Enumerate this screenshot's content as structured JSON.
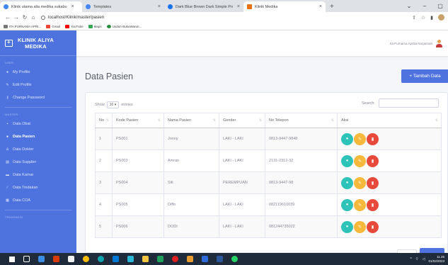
{
  "browser": {
    "tabs": [
      {
        "label": "Klinik utama alia medika sukabu",
        "favicon_color": "#4285f4"
      },
      {
        "label": "Templates",
        "favicon_color": "#4285f4"
      },
      {
        "label": "Dark Blue Brown Dark Simple Pro",
        "favicon_color": "#1a73e8"
      },
      {
        "label": "Klinik Medika",
        "favicon_color": "#e8710a"
      }
    ],
    "url": "localhost/Klinik/master/pasien",
    "bookmarks": [
      {
        "label": "ITA PURNAMA APRI...",
        "color": "#555"
      },
      {
        "label": "Gmail",
        "color": "#ea4335"
      },
      {
        "label": "YouTube",
        "color": "#ff0000"
      },
      {
        "label": "Maps",
        "color": "#34a853"
      },
      {
        "label": "Unduh BukuWarun...",
        "color": "#2a8f3f"
      }
    ]
  },
  "sidebar": {
    "brand_line1": "KLINIK ALIYA",
    "brand_line2": "MEDIKA",
    "sections": {
      "user": "USER",
      "master": "MASTER",
      "transaksi": "TRANSAKSI"
    },
    "user_items": [
      {
        "label": "My Profile",
        "icon": "user-icon"
      },
      {
        "label": "Edit Profile",
        "icon": "user-edit-icon"
      },
      {
        "label": "Change Password",
        "icon": "key-icon"
      }
    ],
    "master_items": [
      {
        "label": "Data Obat",
        "icon": "pills-icon"
      },
      {
        "label": "Data Pasien",
        "icon": "users-icon",
        "active": true
      },
      {
        "label": "Data Dokter",
        "icon": "doctor-icon"
      },
      {
        "label": "Data Supplier",
        "icon": "building-icon"
      },
      {
        "label": "Data Kamar",
        "icon": "bed-icon"
      },
      {
        "label": "Data Tindakan",
        "icon": "syringe-icon"
      },
      {
        "label": "Data COA",
        "icon": "table-icon"
      }
    ]
  },
  "topbar": {
    "user_name": "Ita Purnama Aprilia Nurjannah"
  },
  "main": {
    "title": "Data Pasien",
    "add_button": "+ Tambah Data",
    "show_label": "Show",
    "show_value": "10",
    "entries_label": "entries",
    "search_label": "Search:",
    "columns": [
      "No",
      "Kode Pasien",
      "Nama Pasien",
      "Gender",
      "No Telepon",
      "Aksi"
    ],
    "rows": [
      [
        "1",
        "PS001",
        "Jonny",
        "LAKI - LAKI",
        "0813-9447-9848"
      ],
      [
        "2",
        "PS003",
        "Amran",
        "LAKI - LAKI",
        "2131-2312-32"
      ],
      [
        "3",
        "PS004",
        "Siti",
        "PEREMPUAN",
        "0813-9447-98"
      ],
      [
        "4",
        "PS005",
        "Diffo",
        "LAKI - LAKI",
        "082119610039"
      ],
      [
        "5",
        "PS006",
        "DODI",
        "LAKI - LAKI",
        "081244735022"
      ]
    ]
  },
  "taskbar": {
    "time": "11.25",
    "date": "01/02/2023"
  },
  "colors": {
    "sidebar": "#4e73df",
    "info": "#2ec3b8",
    "edit": "#f6b93b",
    "delete": "#e74a3b"
  }
}
